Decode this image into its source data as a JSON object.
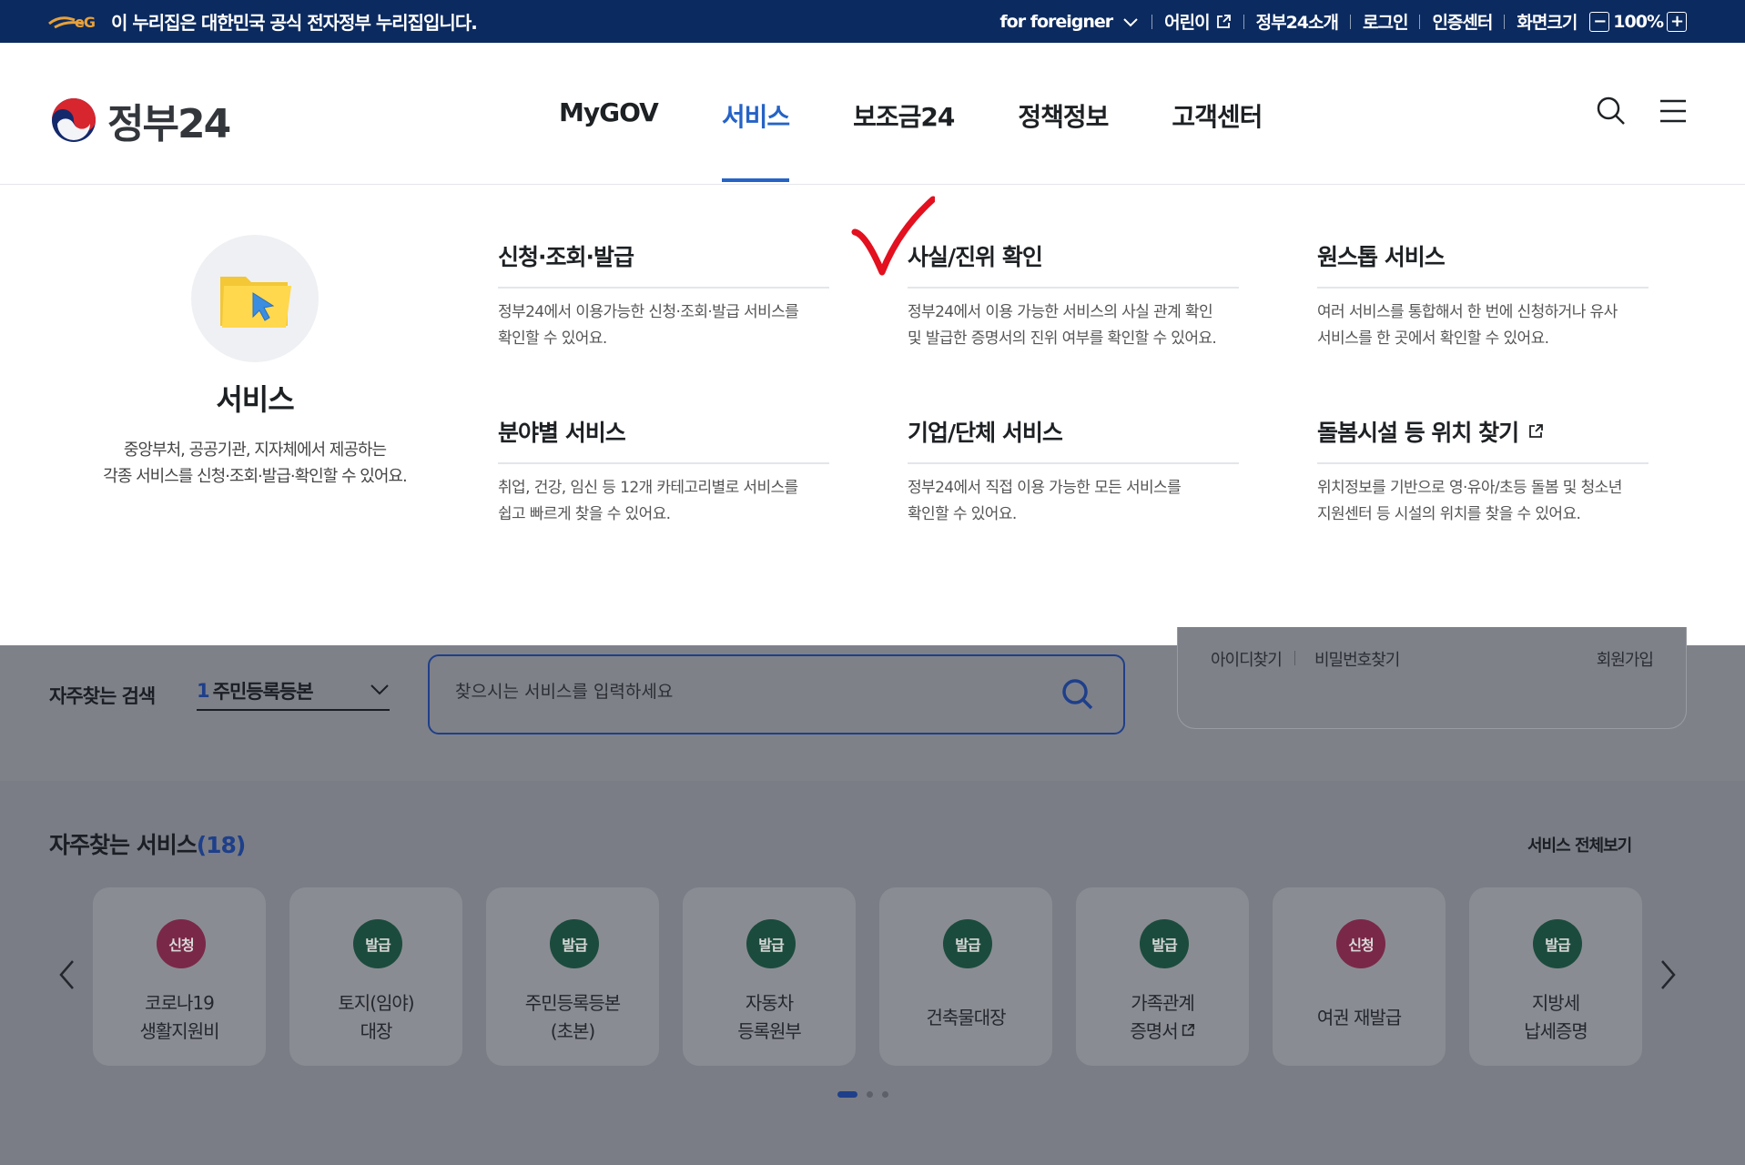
{
  "topbar": {
    "notice": "이 누리집은 대한민국 공식 전자정부 누리집입니다.",
    "links": [
      "for foreigner",
      "어린이",
      "정부24소개",
      "로그인",
      "인증센터"
    ],
    "screen_size_label": "화면크기",
    "zoom": "100%",
    "zoom_minus": "−",
    "zoom_plus": "+"
  },
  "header": {
    "logo_text": "정부24",
    "menu": [
      "MyGOV",
      "서비스",
      "보조금24",
      "정책정보",
      "고객센터"
    ],
    "active_menu": "서비스"
  },
  "mega": {
    "intro_title": "서비스",
    "intro_desc_1": "중앙부처, 공공기관, 지자체에서 제공하는",
    "intro_desc_2": "각종 서비스를 신청·조회·발급·확인할 수 있어요.",
    "items": [
      {
        "title": "신청·조회·발급",
        "desc_1": "정부24에서 이용가능한 신청·조회·발급 서비스를",
        "desc_2": "확인할 수 있어요."
      },
      {
        "title": "사실/진위 확인",
        "desc_1": "정부24에서 이용 가능한 서비스의 사실 관계 확인",
        "desc_2": "및 발급한 증명서의 진위 여부를 확인할 수 있어요."
      },
      {
        "title": "원스톱 서비스",
        "desc_1": "여러 서비스를 통합해서 한 번에 신청하거나 유사",
        "desc_2": "서비스를 한 곳에서 확인할 수 있어요."
      },
      {
        "title": "분야별 서비스",
        "desc_1": "취업, 건강, 임신 등 12개 카테고리별로 서비스를",
        "desc_2": "쉽고 빠르게 찾을 수 있어요."
      },
      {
        "title": "기업/단체 서비스",
        "desc_1": "정부24에서 직접 이용 가능한 모든 서비스를",
        "desc_2": "확인할 수 있어요."
      },
      {
        "title": "돌봄시설 등 위치 찾기",
        "desc_1": "위치정보를 기반으로 영·유아/초등 돌봄 및 청소년",
        "desc_2": "지원센터 등 시설의 위치를 찾을 수 있어요."
      }
    ]
  },
  "search_area": {
    "freq_label": "자주찾는 검색",
    "freq_rank": "1",
    "freq_value": "주민등록등본",
    "placeholder": "찾으시는 서비스를 입력하세요",
    "login_links": [
      "아이디찾기",
      "비밀번호찾기",
      "회원가입"
    ]
  },
  "services": {
    "title": "자주찾는 서비스",
    "count": "(18)",
    "view_all": "서비스 전체보기",
    "tiles": [
      {
        "badge": "신청",
        "badge_color": "red",
        "line1": "코로나19",
        "line2": "생활지원비"
      },
      {
        "badge": "발급",
        "badge_color": "green",
        "line1": "토지(임야)",
        "line2": "대장"
      },
      {
        "badge": "발급",
        "badge_color": "green",
        "line1": "주민등록등본",
        "line2": "(초본)"
      },
      {
        "badge": "발급",
        "badge_color": "green",
        "line1": "자동차",
        "line2": "등록원부"
      },
      {
        "badge": "발급",
        "badge_color": "green",
        "line1": "건축물대장",
        "line2": ""
      },
      {
        "badge": "발급",
        "badge_color": "green",
        "line1": "가족관계",
        "line2": "증명서"
      },
      {
        "badge": "신청",
        "badge_color": "red",
        "line1": "여권 재발급",
        "line2": ""
      },
      {
        "badge": "발급",
        "badge_color": "green",
        "line1": "지방세",
        "line2": "납세증명"
      }
    ],
    "pagination_pages": 3,
    "pagination_current": 1
  },
  "colors": {
    "topbar_bg": "#0b2a5f",
    "accent": "#2563c7",
    "check_mark": "#e3101f",
    "overlay": "#7a7d85"
  }
}
